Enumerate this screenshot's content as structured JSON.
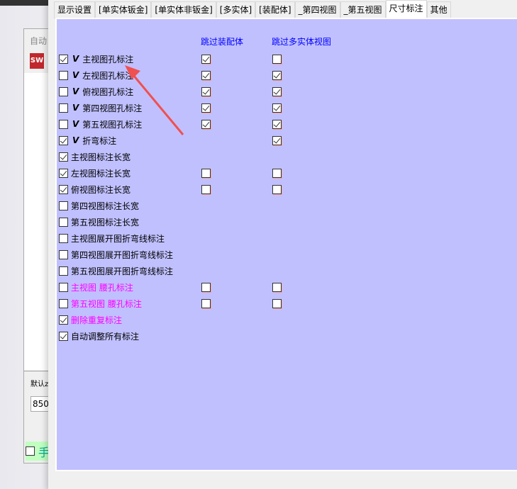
{
  "back_dialog": {
    "title": "自动",
    "logo": "SW",
    "label": "默认z",
    "input_value": "850",
    "green_label": "手"
  },
  "tabs": [
    "显示设置",
    "[单实体钣金]",
    "[单实体非钣金]",
    "[多实体]",
    "[装配体]",
    "_第四视图",
    "_第五视图",
    "尺寸标注",
    "其他"
  ],
  "active_tab": "尺寸标注",
  "headers": {
    "skip_assembly": "跳过装配体",
    "skip_multibody": "跳过多实体视图"
  },
  "colors": {
    "panel": "#c0c0ff",
    "header": "#0000ff",
    "magenta": "#ff00ff",
    "arrow": "#f05050"
  },
  "rows": [
    {
      "label": "主视图孔标注",
      "checked": true,
      "icon": "Vip",
      "col1": true,
      "col2": false
    },
    {
      "label": "左视图孔标注",
      "checked": false,
      "icon": "Vip",
      "col1": true,
      "col2": true
    },
    {
      "label": "俯视图孔标注",
      "checked": false,
      "icon": "Vip",
      "col1": true,
      "col2": true
    },
    {
      "label": "第四视图孔标注",
      "checked": false,
      "icon": "Vip",
      "col1": true,
      "col2": true
    },
    {
      "label": "第五视图孔标注",
      "checked": false,
      "icon": "Vsn",
      "col1": true,
      "col2": true
    },
    {
      "label": "折弯标注",
      "checked": true,
      "icon": "Vsn",
      "col1": null,
      "col2": true
    },
    {
      "label": "主视图标注长宽",
      "checked": true,
      "col1": null,
      "col2": null
    },
    {
      "label": "左视图标注长宽",
      "checked": true,
      "col1": false,
      "col2": false
    },
    {
      "label": "俯视图标注长宽",
      "checked": true,
      "col1": false,
      "col2": false
    },
    {
      "label": "第四视图标注长宽",
      "checked": false,
      "col1": null,
      "col2": null
    },
    {
      "label": "第五视图标注长宽",
      "checked": false,
      "col1": null,
      "col2": null
    },
    {
      "label": "主视图展开图折弯线标注",
      "checked": false,
      "col1": null,
      "col2": null
    },
    {
      "label": "第四视图展开图折弯线标注",
      "checked": false,
      "col1": null,
      "col2": null
    },
    {
      "label": "第五视图展开图折弯线标注",
      "checked": false,
      "col1": null,
      "col2": null
    },
    {
      "label": "主视图  腰孔标注",
      "checked": false,
      "color": "magenta",
      "col1": false,
      "col2": false
    },
    {
      "label": "第五视图  腰孔标注",
      "checked": false,
      "color": "magenta",
      "col1": false,
      "col2": false
    },
    {
      "label": "删除重复标注",
      "checked": true,
      "color": "magenta",
      "col1": null,
      "col2": null
    },
    {
      "label": "自动调整所有标注",
      "checked": true,
      "col1": null,
      "col2": null
    }
  ]
}
